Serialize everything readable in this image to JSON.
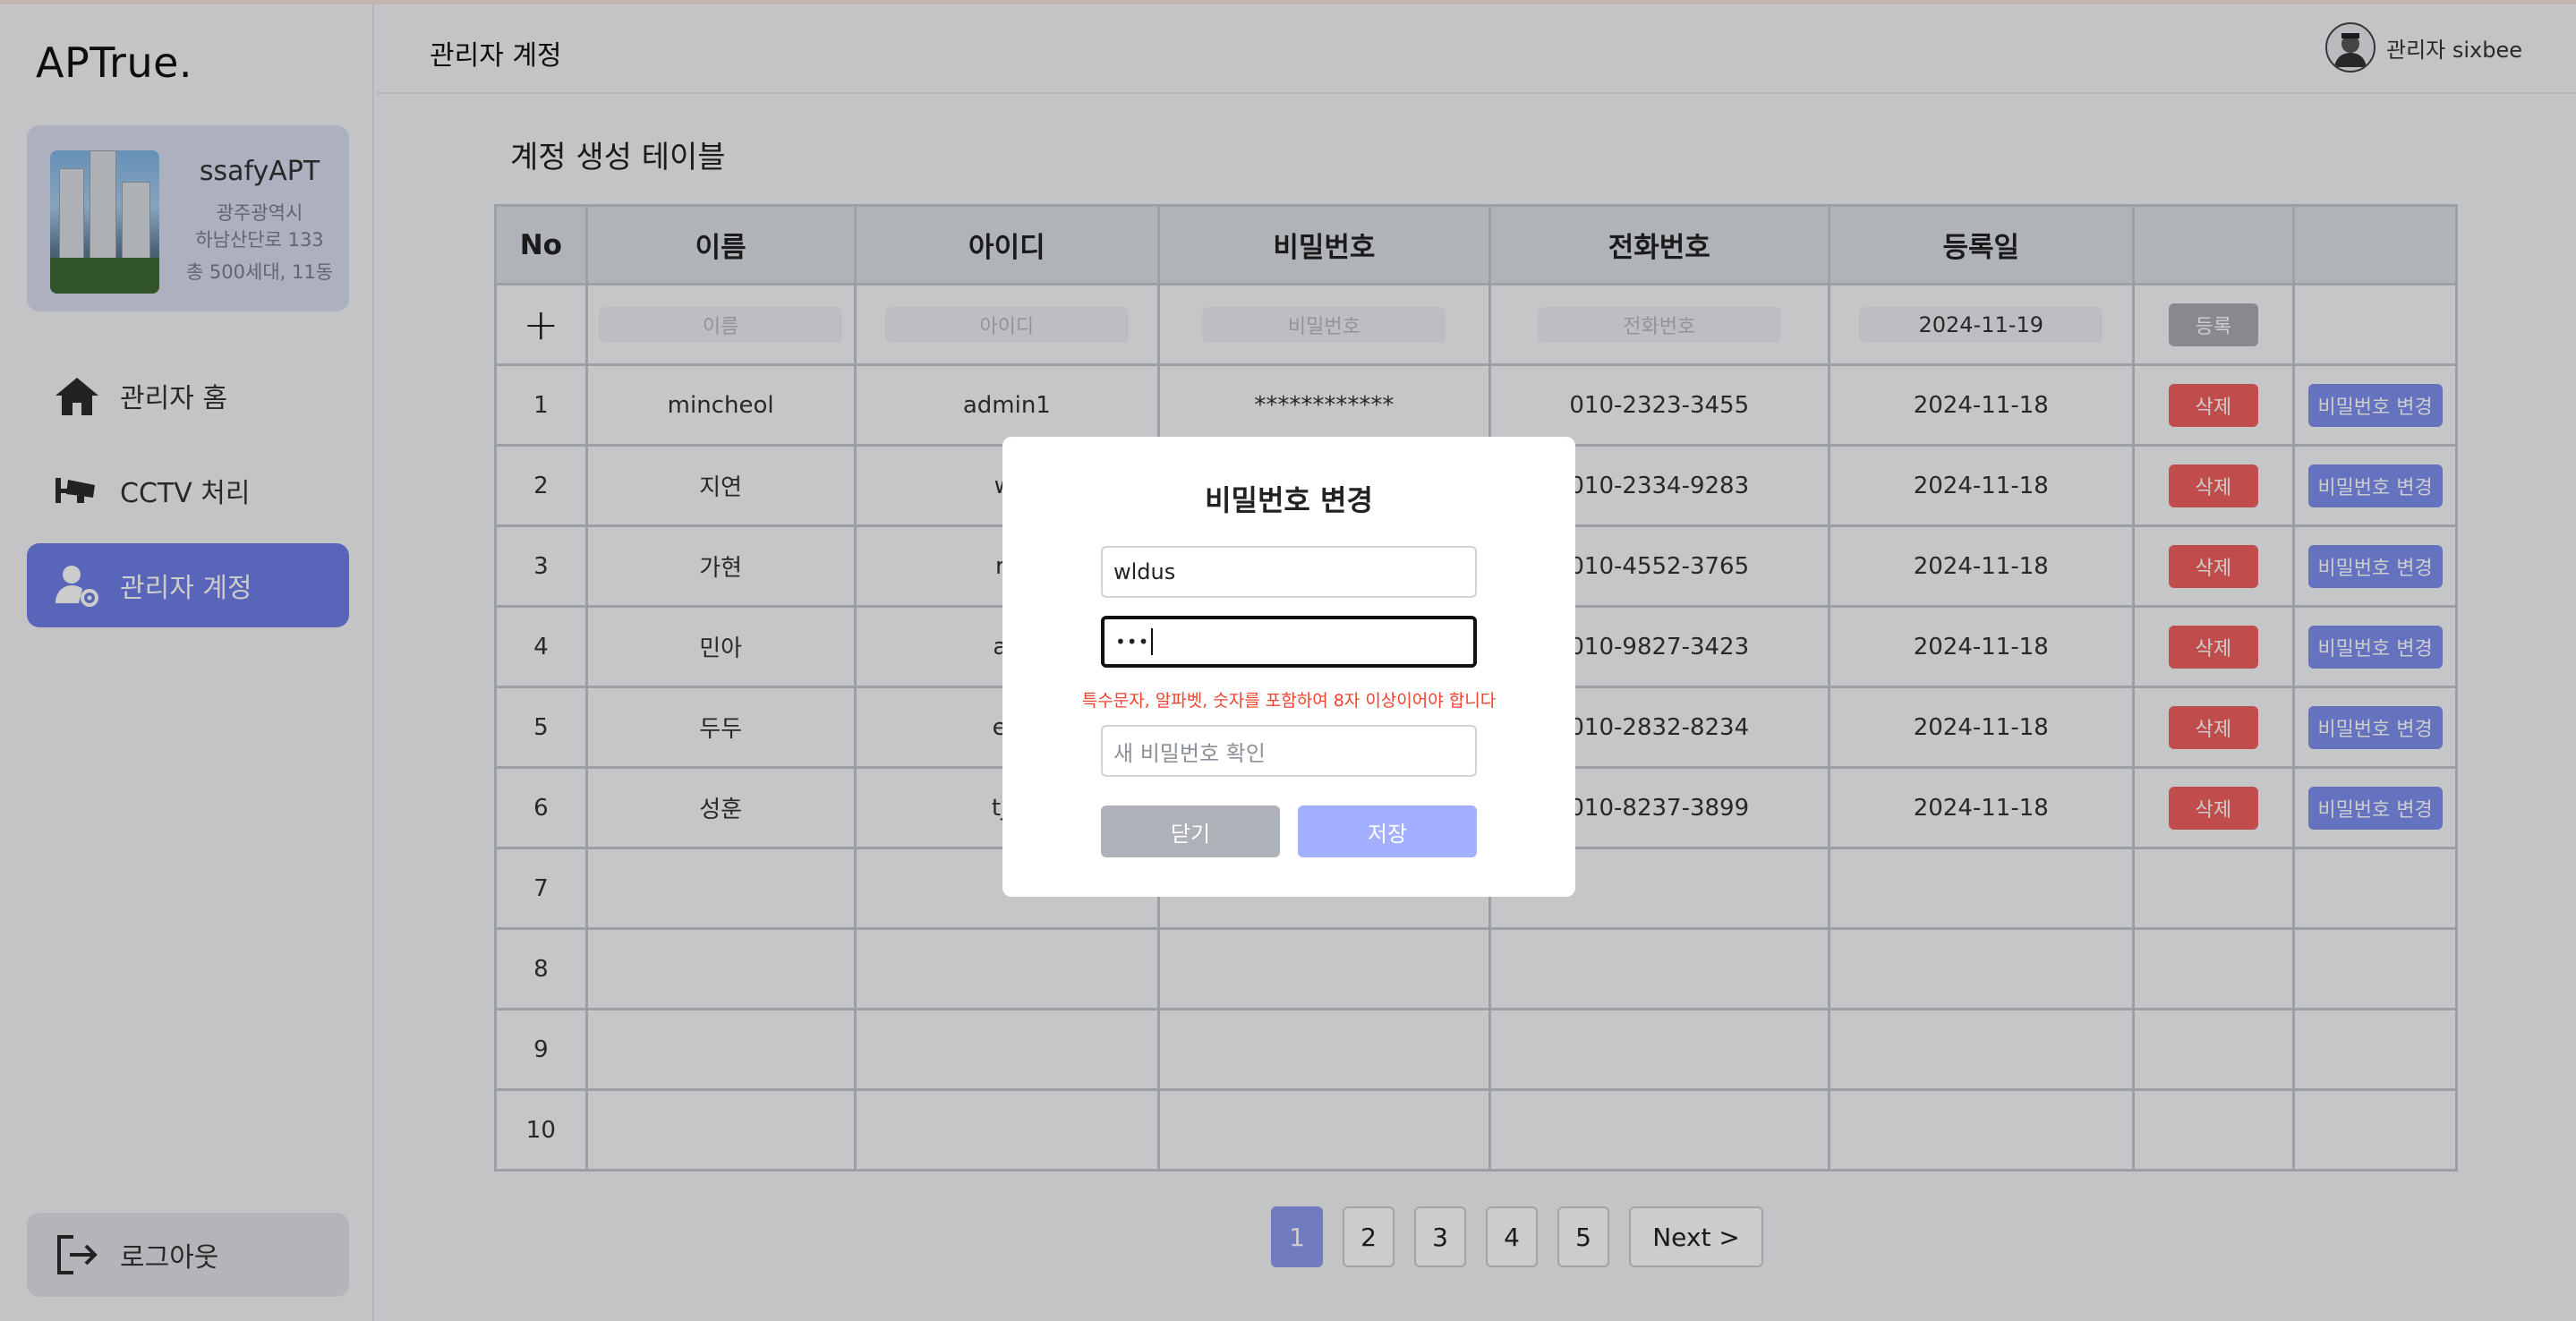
{
  "app": {
    "logo": "APTrue."
  },
  "apartment": {
    "name": "ssafyAPT",
    "city": "광주광역시",
    "street": "하남산단로 133",
    "summary": "총 500세대, 11동"
  },
  "sidebar": {
    "items": [
      {
        "label": "관리자 홈",
        "icon": "home-icon",
        "active": false
      },
      {
        "label": "CCTV 처리",
        "icon": "cctv-icon",
        "active": false
      },
      {
        "label": "관리자 계정",
        "icon": "user-gear-icon",
        "active": true
      }
    ],
    "logout_label": "로그아웃"
  },
  "header": {
    "title": "관리자 계정",
    "user_label": "관리자 sixbee"
  },
  "main": {
    "section_title": "계정 생성 테이블",
    "columns": [
      "No",
      "이름",
      "아이디",
      "비밀번호",
      "전화번호",
      "등록일",
      "",
      ""
    ],
    "add_row": {
      "plus": "+",
      "name_placeholder": "이름",
      "id_placeholder": "아이디",
      "pw_placeholder": "비밀번호",
      "phone_placeholder": "전화번호",
      "date_value": "2024-11-19",
      "register_label": "등록"
    },
    "rows": [
      {
        "no": "1",
        "name": "mincheol",
        "id": "admin1",
        "pw": "************",
        "phone": "010-2323-3455",
        "date": "2024-11-18",
        "delete": "삭제",
        "change": "비밀번호 변경"
      },
      {
        "no": "2",
        "name": "지연",
        "id": "wl",
        "pw": "",
        "phone": "010-2334-9283",
        "date": "2024-11-18",
        "delete": "삭제",
        "change": "비밀번호 변경"
      },
      {
        "no": "3",
        "name": "가현",
        "id": "rk",
        "pw": "",
        "phone": "010-4552-3765",
        "date": "2024-11-18",
        "delete": "삭제",
        "change": "비밀번호 변경"
      },
      {
        "no": "4",
        "name": "민아",
        "id": "ak",
        "pw": "",
        "phone": "010-9827-3423",
        "date": "2024-11-18",
        "delete": "삭제",
        "change": "비밀번호 변경"
      },
      {
        "no": "5",
        "name": "두두",
        "id": "en",
        "pw": "",
        "phone": "010-2832-8234",
        "date": "2024-11-18",
        "delete": "삭제",
        "change": "비밀번호 변경"
      },
      {
        "no": "6",
        "name": "성훈",
        "id": "tjd",
        "pw": "",
        "phone": "010-8237-3899",
        "date": "2024-11-18",
        "delete": "삭제",
        "change": "비밀번호 변경"
      },
      {
        "no": "7"
      },
      {
        "no": "8"
      },
      {
        "no": "9"
      },
      {
        "no": "10"
      }
    ]
  },
  "pagination": {
    "pages": [
      "1",
      "2",
      "3",
      "4",
      "5"
    ],
    "active": "1",
    "next_label": "Next  >"
  },
  "modal": {
    "title": "비밀번호 변경",
    "username_value": "wldus",
    "password_value": "•••",
    "error": "특수문자, 알파벳, 숫자를 포함하여 8자 이상이어야 합니다",
    "confirm_placeholder": "새 비밀번호 확인",
    "close_label": "닫기",
    "save_label": "저장"
  },
  "colors": {
    "accent": "#6f7fe8",
    "danger": "#f0605f",
    "button_secondary": "#7f8ff1",
    "error_text": "#f0432f"
  }
}
